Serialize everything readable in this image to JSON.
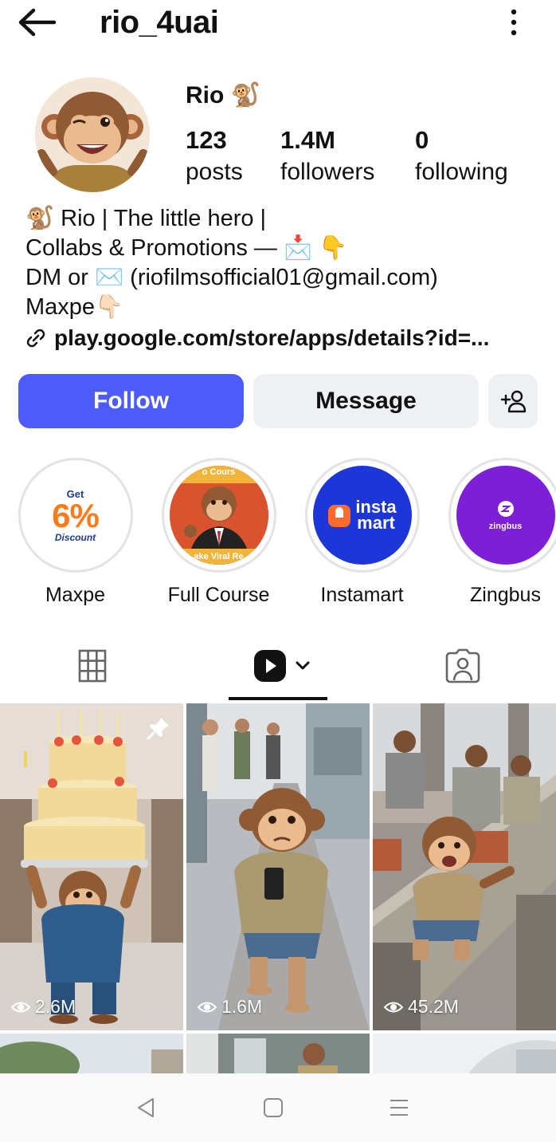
{
  "header": {
    "username": "rio_4uai",
    "back_icon": "arrow-left-icon",
    "more_icon": "more-vertical-icon"
  },
  "profile": {
    "display_name": "Rio 🐒",
    "stats": [
      {
        "value": "123",
        "label": "posts"
      },
      {
        "value": "1.4M",
        "label": "followers"
      },
      {
        "value": "0",
        "label": "following"
      }
    ],
    "bio_lines": [
      "🐒 Rio | The little hero |",
      "Collabs & Promotions — 📩 👇",
      "DM or ✉️ (riofilmsofficial01@gmail.com)",
      "Maxpe👇🏻"
    ],
    "link": "play.google.com/store/apps/details?id=..."
  },
  "actions": {
    "follow": "Follow",
    "message": "Message",
    "add_user_icon": "person-add-icon"
  },
  "highlights": [
    {
      "label": "Maxpe",
      "badge_top": "Get",
      "badge_main": "6%",
      "badge_bottom": "Discount"
    },
    {
      "label": "Full Course",
      "banner_top": "o Cours",
      "banner_bottom": "ake Viral Re"
    },
    {
      "label": "Instamart",
      "logo_line1": "insta",
      "logo_line2": "mart"
    },
    {
      "label": "Zingbus",
      "logo_text": "zingbus"
    }
  ],
  "tabs": [
    {
      "name": "grid-tab",
      "icon": "grid-icon"
    },
    {
      "name": "reels-tab",
      "icon": "reels-icon"
    },
    {
      "name": "tagged-tab",
      "icon": "tagged-person-icon"
    }
  ],
  "posts": [
    {
      "views": "2.6M",
      "pinned": true
    },
    {
      "views": "1.6M",
      "pinned": false
    },
    {
      "views": "45.2M",
      "pinned": false
    }
  ],
  "colors": {
    "follow_button": "#4d5bf9",
    "secondary_button": "#eff0f4",
    "instamart_bg": "#1d36d8",
    "zingbus_bg": "#7c1fd6",
    "maxpe_orange": "#ff7a1a"
  },
  "navbar": [
    "back-nav-icon",
    "home-nav-icon",
    "recents-nav-icon"
  ]
}
